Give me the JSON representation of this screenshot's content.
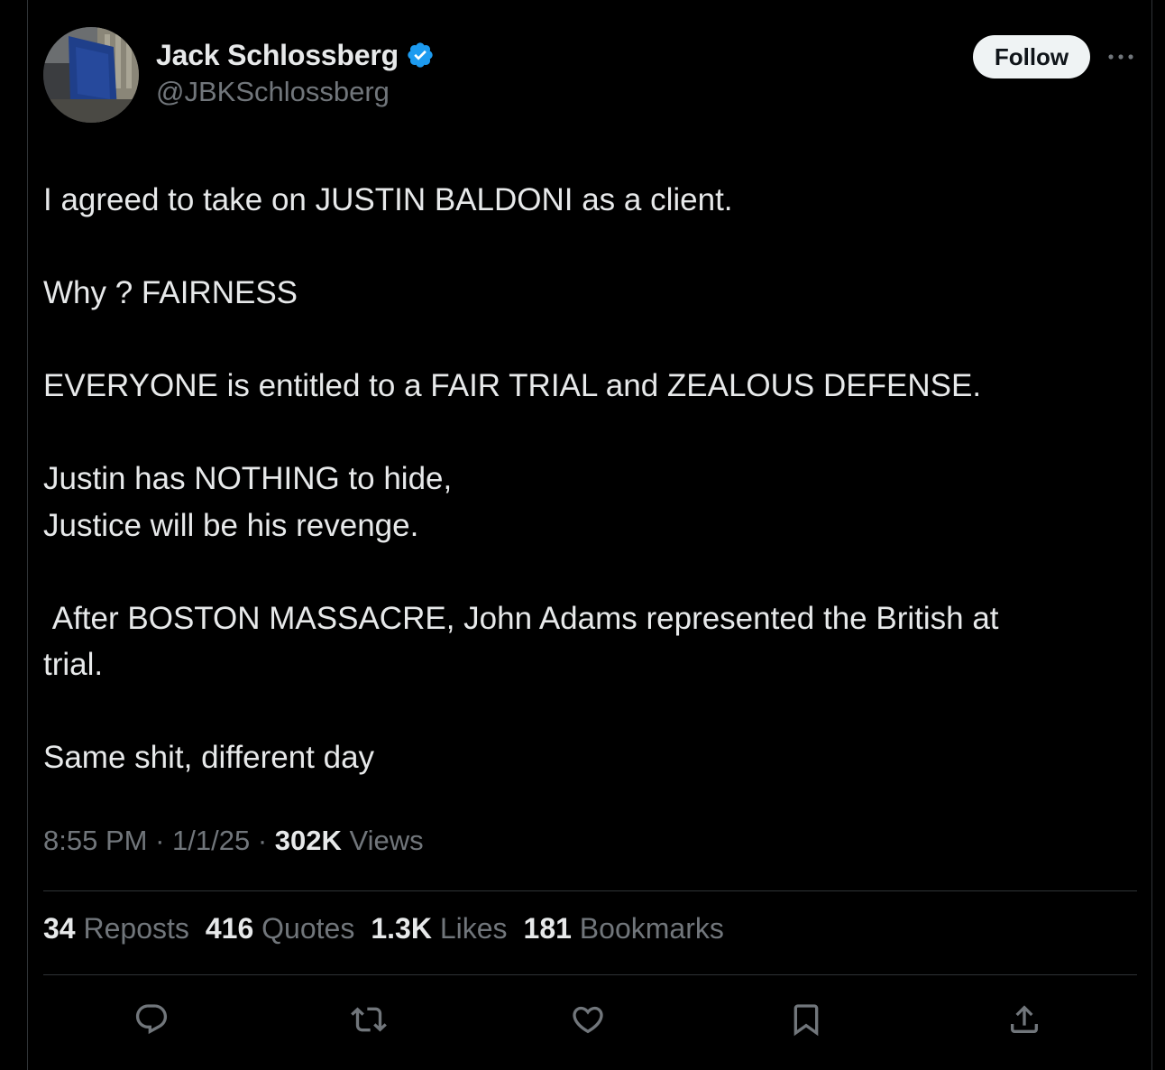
{
  "author": {
    "display_name": "Jack Schlossberg",
    "handle": "@JBKSchlossberg",
    "verified": true,
    "verified_color": "#1d9bf0"
  },
  "follow_label": "Follow",
  "tweet": {
    "paragraphs": [
      [
        "I agreed to take on JUSTIN BALDONI as a client."
      ],
      [
        "Why ? FAIRNESS"
      ],
      [
        "EVERYONE is entitled to a FAIR TRIAL and ZEALOUS DEFENSE."
      ],
      [
        "Justin has NOTHING to hide,",
        "Justice will be his revenge."
      ],
      [
        " After BOSTON MASSACRE, John Adams represented the British at",
        "trial."
      ],
      [
        "Same shit, different day"
      ]
    ]
  },
  "meta": {
    "time": "8:55 PM",
    "sep": " · ",
    "date": "1/1/25",
    "views_count": "302K",
    "views_label": " Views"
  },
  "stats": {
    "reposts": {
      "count": "34",
      "label": " Reposts"
    },
    "quotes": {
      "count": "416",
      "label": " Quotes"
    },
    "likes": {
      "count": "1.3K",
      "label": " Likes"
    },
    "bookmarks": {
      "count": "181",
      "label": " Bookmarks"
    }
  },
  "icons": {
    "reply": "reply-icon",
    "repost": "repost-icon",
    "like": "heart-icon",
    "bookmark": "bookmark-icon",
    "share": "share-icon",
    "more": "more-icon"
  },
  "colors": {
    "background": "#000000",
    "text": "#e7e9ea",
    "secondary": "#71767b",
    "divider": "#2f3336"
  }
}
